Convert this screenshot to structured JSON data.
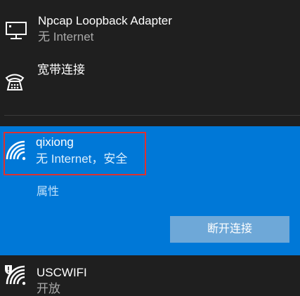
{
  "networks": {
    "npcap": {
      "name": "Npcap Loopback Adapter",
      "status": "无 Internet",
      "icon": "ethernet-monitor-icon"
    },
    "broadband": {
      "name": "宽带连接",
      "icon": "dialup-icon"
    },
    "selected": {
      "name": "qixiong",
      "status": "无 Internet，安全",
      "icon": "wifi-icon",
      "properties_label": "属性",
      "disconnect_label": "断开连接",
      "accent_color": "#0078d7"
    },
    "uscwifi": {
      "name": "USCWIFI",
      "status": "开放",
      "icon": "wifi-open-warning-icon"
    }
  }
}
